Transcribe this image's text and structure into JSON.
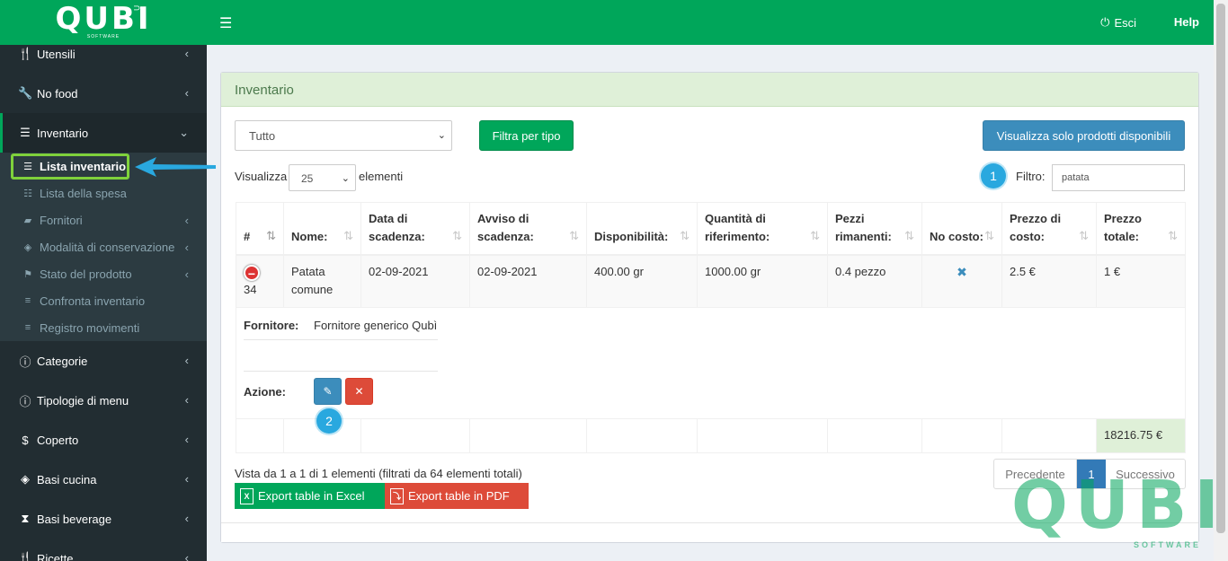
{
  "app": {
    "logo": "QUBI",
    "logo_sub": "SOFTWARE"
  },
  "topbar": {
    "exit_label": "Esci",
    "help_label": "Help"
  },
  "sidebar": {
    "items": [
      {
        "label": "Utensili",
        "icon": "cutlery-icon"
      },
      {
        "label": "No food",
        "icon": "wrench-icon"
      },
      {
        "label": "Inventario",
        "icon": "list-icon"
      },
      {
        "label": "Categorie",
        "icon": "info-circle-icon"
      },
      {
        "label": "Tipologie di menu",
        "icon": "info-circle-icon"
      },
      {
        "label": "Coperto",
        "icon": "dollar-icon"
      },
      {
        "label": "Basi cucina",
        "icon": "cube-icon"
      },
      {
        "label": "Basi beverage",
        "icon": "hourglass-icon"
      },
      {
        "label": "Ricette",
        "icon": "cutlery-icon"
      }
    ],
    "submenu": [
      {
        "label": "Lista inventario",
        "icon": "list-icon"
      },
      {
        "label": "Lista della spesa",
        "icon": "list-ol-icon"
      },
      {
        "label": "Fornitori",
        "icon": "truck-icon"
      },
      {
        "label": "Modalità di conservazione",
        "icon": "cube-icon"
      },
      {
        "label": "Stato del prodotto",
        "icon": "flag-icon"
      },
      {
        "label": "Confronta inventario",
        "icon": "bars-icon"
      },
      {
        "label": "Registro movimenti",
        "icon": "bars-icon"
      }
    ]
  },
  "box": {
    "title": "Inventario",
    "type_select_value": "Tutto",
    "filter_button": "Filtra per tipo",
    "available_button": "Visualizza solo prodotti disponibili",
    "length_label_before": "Visualizza",
    "length_value": "25",
    "length_label_after": "elementi",
    "filter_label": "Filtro:",
    "filter_value": "patata",
    "badge_1": "1",
    "badge_2": "2"
  },
  "table": {
    "headers": [
      "#",
      "Nome:",
      "Data di scadenza:",
      "Avviso di scadenza:",
      "Disponibilità:",
      "Quantità di riferimento:",
      "Pezzi rimanenti:",
      "No costo:",
      "Prezzo di costo:",
      "Prezzo totale:"
    ],
    "row": {
      "id": "34",
      "name": "Patata comune",
      "expiry": "02-09-2021",
      "warning": "02-09-2021",
      "availability": "400.00 gr",
      "reference": "1000.00 gr",
      "pieces": "0.4 pezzo",
      "no_cost": "✖",
      "cost_price": "2.5 €",
      "total_price": "1 €"
    },
    "detail": {
      "supplier_label": "Fornitore:",
      "supplier_value": "Fornitore generico Qubì",
      "action_label": "Azione:"
    },
    "total": "18216.75 €"
  },
  "footer": {
    "info": "Vista da 1 a 1 di 1 elementi (filtrati da 64 elementi totali)",
    "export_excel": "Export table in Excel",
    "export_pdf": "Export table in PDF",
    "prev": "Precedente",
    "page": "1",
    "next": "Successivo"
  },
  "watermark": {
    "text": "QUBI",
    "sub": "SOFTWARE"
  },
  "colors": {
    "brand_green": "#00a65a",
    "sidebar_bg": "#222d32",
    "primary_blue": "#3c8dbc",
    "danger_red": "#dd4b39",
    "highlight_green": "#7fd13b",
    "badge_blue": "#29a8df"
  }
}
